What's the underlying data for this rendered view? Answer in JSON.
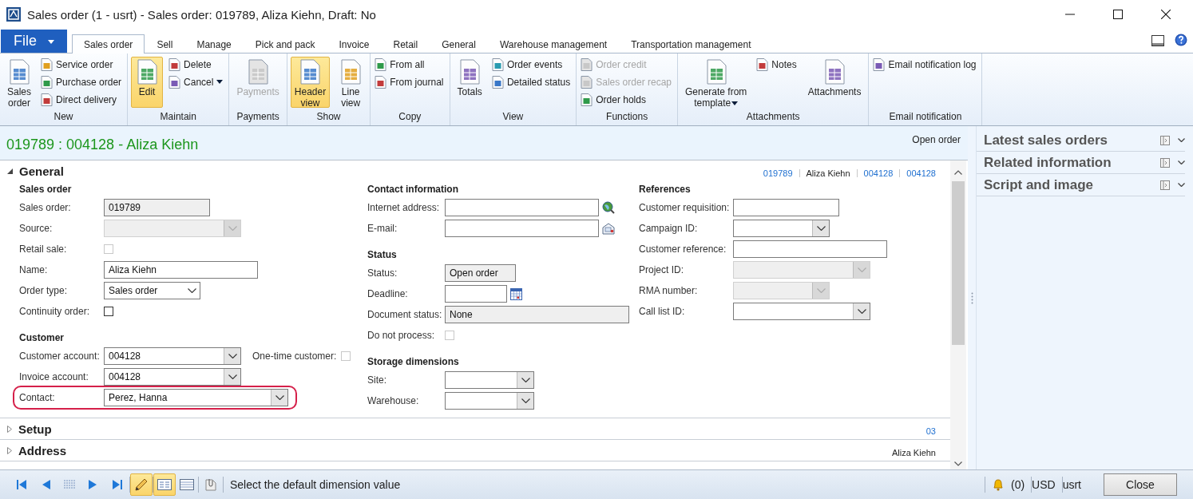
{
  "window": {
    "title": "Sales order (1 - usrt) - Sales order: 019789, Aliza Kiehn, Draft: No"
  },
  "file_button": {
    "label": "File"
  },
  "ribbon_tabs": [
    {
      "label": "Sales order",
      "selected": true
    },
    {
      "label": "Sell",
      "selected": false
    },
    {
      "label": "Manage",
      "selected": false
    },
    {
      "label": "Pick and pack",
      "selected": false
    },
    {
      "label": "Invoice",
      "selected": false
    },
    {
      "label": "Retail",
      "selected": false
    },
    {
      "label": "General",
      "selected": false
    },
    {
      "label": "Warehouse management",
      "selected": false
    },
    {
      "label": "Transportation management",
      "selected": false
    }
  ],
  "ribbon_groups": [
    {
      "label": "New",
      "items": [
        {
          "kind": "large",
          "lines": [
            "Sales",
            "order"
          ],
          "selected": false,
          "disabled": false,
          "dropdown": false
        },
        {
          "kind": "small",
          "lines": [
            "Service order"
          ],
          "selected": false,
          "disabled": false,
          "dropdown": false
        },
        {
          "kind": "small",
          "lines": [
            "Purchase order"
          ],
          "selected": false,
          "disabled": false,
          "dropdown": false
        },
        {
          "kind": "small",
          "lines": [
            "Direct delivery"
          ],
          "selected": false,
          "disabled": false,
          "dropdown": false
        }
      ]
    },
    {
      "label": "Maintain",
      "items": [
        {
          "kind": "large",
          "lines": [
            "Edit"
          ],
          "selected": true,
          "disabled": false,
          "dropdown": false
        },
        {
          "kind": "small",
          "lines": [
            "Delete"
          ],
          "selected": false,
          "disabled": false,
          "dropdown": false
        },
        {
          "kind": "small",
          "lines": [
            "Cancel"
          ],
          "selected": false,
          "disabled": false,
          "dropdown": true
        }
      ]
    },
    {
      "label": "Payments",
      "items": [
        {
          "kind": "large",
          "lines": [
            "Payments"
          ],
          "selected": false,
          "disabled": true,
          "dropdown": false
        }
      ]
    },
    {
      "label": "Show",
      "items": [
        {
          "kind": "large",
          "lines": [
            "Header",
            "view"
          ],
          "selected": true,
          "disabled": false,
          "dropdown": false
        },
        {
          "kind": "large",
          "lines": [
            "Line",
            "view"
          ],
          "selected": false,
          "disabled": false,
          "dropdown": false
        }
      ]
    },
    {
      "label": "Copy",
      "items": [
        {
          "kind": "small",
          "lines": [
            "From all"
          ],
          "selected": false,
          "disabled": false,
          "dropdown": false
        },
        {
          "kind": "small",
          "lines": [
            "From journal"
          ],
          "selected": false,
          "disabled": false,
          "dropdown": false
        }
      ]
    },
    {
      "label": "View",
      "items": [
        {
          "kind": "large",
          "lines": [
            "Totals"
          ],
          "selected": false,
          "disabled": false,
          "dropdown": false
        },
        {
          "kind": "small",
          "lines": [
            "Order events"
          ],
          "selected": false,
          "disabled": false,
          "dropdown": false
        },
        {
          "kind": "small",
          "lines": [
            "Detailed status"
          ],
          "selected": false,
          "disabled": false,
          "dropdown": false
        }
      ]
    },
    {
      "label": "Functions",
      "items": [
        {
          "kind": "small",
          "lines": [
            "Order credit"
          ],
          "selected": false,
          "disabled": true,
          "dropdown": false
        },
        {
          "kind": "small",
          "lines": [
            "Sales order recap"
          ],
          "selected": false,
          "disabled": true,
          "dropdown": false
        },
        {
          "kind": "small",
          "lines": [
            "Order holds"
          ],
          "selected": false,
          "disabled": false,
          "dropdown": false
        }
      ]
    },
    {
      "label": "Attachments",
      "items": [
        {
          "kind": "large",
          "lines": [
            "Generate from",
            "template"
          ],
          "selected": false,
          "disabled": false,
          "dropdown": true
        },
        {
          "kind": "small",
          "lines": [
            "Notes"
          ],
          "selected": false,
          "disabled": false,
          "dropdown": false
        },
        {
          "kind": "large",
          "lines": [
            "Attachments"
          ],
          "selected": false,
          "disabled": false,
          "dropdown": false
        }
      ]
    },
    {
      "label": "Email notification",
      "items": [
        {
          "kind": "small",
          "lines": [
            "Email notification log"
          ],
          "selected": false,
          "disabled": false,
          "dropdown": false
        }
      ]
    }
  ],
  "form": {
    "title": "019789 : 004128 - Aliza Kiehn",
    "status": "Open order",
    "sections": [
      {
        "title": "General",
        "expanded": true,
        "summary": [
          {
            "text": "019789",
            "link": true
          },
          {
            "text": "Aliza Kiehn",
            "link": false
          },
          {
            "text": "004128",
            "link": true
          },
          {
            "text": "004128",
            "link": true
          }
        ],
        "columns": [
          {
            "groups": [
              {
                "title": "Sales order",
                "fields": [
                  {
                    "label": "Sales order:",
                    "kind": "text",
                    "value": "019789",
                    "read_only": true,
                    "disabled": false
                  },
                  {
                    "label": "Source:",
                    "kind": "combo",
                    "read_only": false,
                    "disabled": true
                  },
                  {
                    "label": "Retail sale:",
                    "kind": "check",
                    "checked": false,
                    "disabled": true
                  },
                  {
                    "label": "Name:",
                    "kind": "text",
                    "value": "Aliza Kiehn",
                    "read_only": false,
                    "disabled": false
                  },
                  {
                    "label": "Order type:",
                    "kind": "combo",
                    "value": "Sales order",
                    "read_only": false,
                    "disabled": false
                  },
                  {
                    "label": "Continuity order:",
                    "kind": "check",
                    "checked": false,
                    "disabled": false
                  }
                ]
              },
              {
                "title": "Customer",
                "fields": [
                  {
                    "label": "Customer account:",
                    "kind": "combo",
                    "value": "004128",
                    "read_only": false,
                    "disabled": false,
                    "aside": {
                      "label": "One-time customer:",
                      "checked": false
                    }
                  },
                  {
                    "label": "Invoice account:",
                    "kind": "combo",
                    "value": "004128",
                    "read_only": false,
                    "disabled": false
                  },
                  {
                    "label": "Contact:",
                    "kind": "combo",
                    "value": "Perez, Hanna",
                    "read_only": false,
                    "disabled": false,
                    "highlighted": true
                  }
                ]
              }
            ]
          },
          {
            "groups": [
              {
                "title": "Contact information",
                "fields": [
                  {
                    "label": "Internet address:",
                    "kind": "url",
                    "read_only": false,
                    "disabled": false
                  },
                  {
                    "label": "E-mail:",
                    "kind": "email",
                    "read_only": false,
                    "disabled": false
                  }
                ]
              },
              {
                "title": "Status",
                "fields": [
                  {
                    "label": "Status:",
                    "kind": "text",
                    "value": "Open order",
                    "read_only": true,
                    "disabled": false
                  },
                  {
                    "label": "Deadline:",
                    "kind": "date",
                    "read_only": false,
                    "disabled": false
                  },
                  {
                    "label": "Document status:",
                    "kind": "text",
                    "value": "None",
                    "read_only": true,
                    "disabled": false
                  },
                  {
                    "label": "Do not process:",
                    "kind": "check",
                    "checked": false,
                    "disabled": true
                  }
                ]
              },
              {
                "title": "Storage dimensions",
                "fields": [
                  {
                    "label": "Site:",
                    "kind": "combo",
                    "read_only": false,
                    "disabled": false
                  },
                  {
                    "label": "Warehouse:",
                    "kind": "combo",
                    "read_only": false,
                    "disabled": false
                  }
                ]
              }
            ]
          },
          {
            "groups": [
              {
                "title": "References",
                "fields": [
                  {
                    "label": "Customer requisition:",
                    "kind": "text",
                    "read_only": false,
                    "disabled": false
                  },
                  {
                    "label": "Campaign ID:",
                    "kind": "combo",
                    "read_only": false,
                    "disabled": false
                  },
                  {
                    "label": "Customer reference:",
                    "kind": "text",
                    "read_only": false,
                    "disabled": false
                  },
                  {
                    "label": "Project ID:",
                    "kind": "combo",
                    "read_only": false,
                    "disabled": true
                  },
                  {
                    "label": "RMA number:",
                    "kind": "combo",
                    "read_only": false,
                    "disabled": true
                  },
                  {
                    "label": "Call list ID:",
                    "kind": "combo",
                    "read_only": false,
                    "disabled": false
                  }
                ]
              }
            ]
          }
        ]
      },
      {
        "title": "Setup",
        "expanded": false,
        "summary": [
          {
            "text": "03",
            "link": true
          }
        ]
      },
      {
        "title": "Address",
        "expanded": false,
        "summary": [
          {
            "text": "Aliza Kiehn",
            "link": false
          }
        ]
      }
    ]
  },
  "factboxes": [
    {
      "title": "Latest sales orders",
      "expanded": false
    },
    {
      "title": "Related information",
      "expanded": false
    },
    {
      "title": "Script and image",
      "expanded": false
    }
  ],
  "status_bar": {
    "edit_mode": true,
    "views": [
      {
        "selected": true
      },
      {
        "selected": false
      }
    ],
    "message": "Select the default dimension value",
    "notifications": "(0)",
    "currency": "USD",
    "user": "usrt",
    "close_button": "Close"
  }
}
